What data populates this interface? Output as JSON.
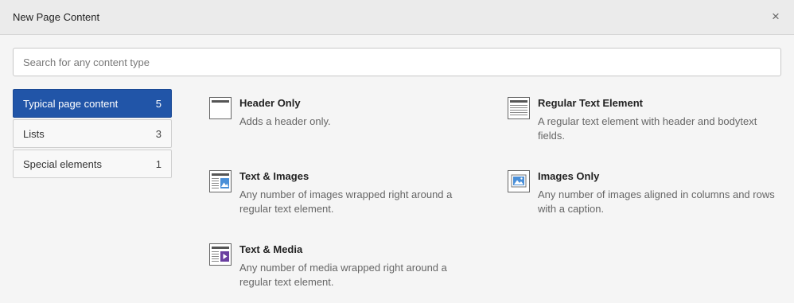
{
  "modal": {
    "title": "New Page Content",
    "close_icon": "×"
  },
  "search": {
    "placeholder": "Search for any content type",
    "value": ""
  },
  "tabs": [
    {
      "label": "Typical page content",
      "count": "5",
      "active": true
    },
    {
      "label": "Lists",
      "count": "3",
      "active": false
    },
    {
      "label": "Special elements",
      "count": "1",
      "active": false
    }
  ],
  "content_types": [
    {
      "title": "Header Only",
      "description": "Adds a header only.",
      "icon": "content-header-icon"
    },
    {
      "title": "Regular Text Element",
      "description": "A regular text element with header and bodytext fields.",
      "icon": "content-text-icon"
    },
    {
      "title": "Text & Images",
      "description": "Any number of images wrapped right around a regular text element.",
      "icon": "content-textpic-icon"
    },
    {
      "title": "Images Only",
      "description": "Any number of images aligned in columns and rows with a caption.",
      "icon": "content-image-icon"
    },
    {
      "title": "Text & Media",
      "description": "Any number of media wrapped right around a regular text element.",
      "icon": "content-textmedia-icon"
    }
  ],
  "colors": {
    "active_tab": "#2155a8",
    "icon_image": "#4a8fd8",
    "icon_media": "#6a3fa0"
  }
}
